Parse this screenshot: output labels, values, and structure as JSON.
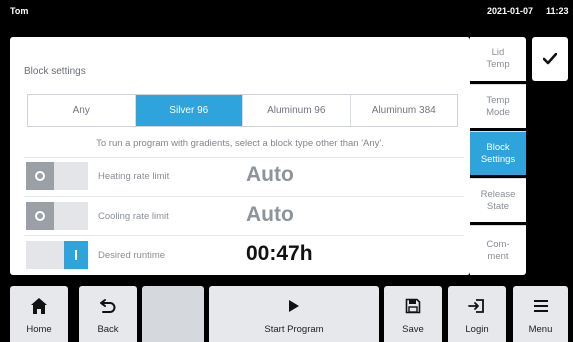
{
  "status": {
    "user": "Tom",
    "date": "2021-01-07",
    "time": "11:23"
  },
  "panel": {
    "title": "Block settings",
    "block_types": [
      "Any",
      "Silver 96",
      "Aluminum 96",
      "Aluminum 384"
    ],
    "selected_block_type": "Silver 96",
    "hint": "To run a program with gradients, select a block type other than 'Any'.",
    "rows": [
      {
        "label": "Heating rate limit",
        "value": "Auto",
        "toggle": "off"
      },
      {
        "label": "Cooling rate limit",
        "value": "Auto",
        "toggle": "off"
      },
      {
        "label": "Desired runtime",
        "value": "00:47h",
        "toggle": "on"
      }
    ]
  },
  "side_tabs": [
    {
      "label": "Lid\nTemp",
      "active": false
    },
    {
      "label": "Temp\nMode",
      "active": false
    },
    {
      "label": "Block\nSettings",
      "active": true
    },
    {
      "label": "Release\nState",
      "active": false
    },
    {
      "label": "Com-\nment",
      "active": false
    }
  ],
  "confirm_icon": "checkmark-icon",
  "bottom": {
    "home": "Home",
    "back": "Back",
    "start": "Start Program",
    "save": "Save",
    "login": "Login",
    "menu": "Menu"
  },
  "colors": {
    "accent": "#2ea3dc",
    "background": "#000000",
    "panel": "#ffffff"
  }
}
